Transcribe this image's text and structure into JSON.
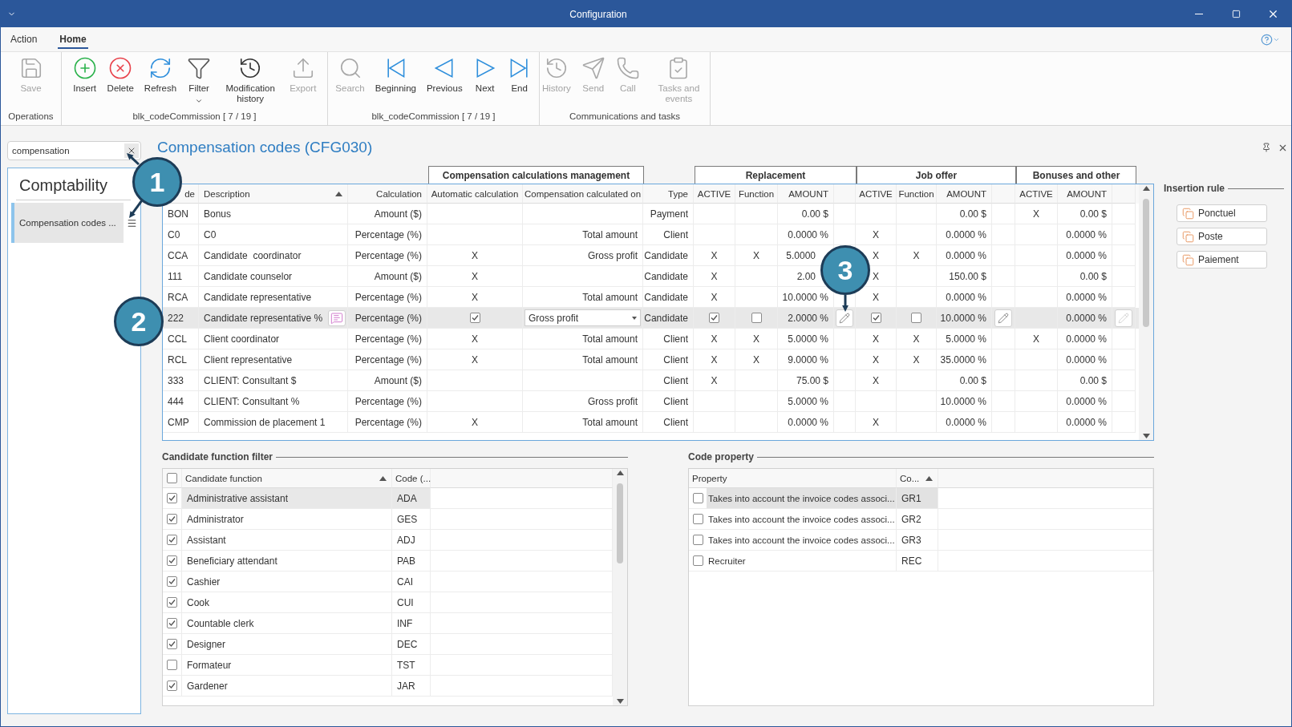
{
  "window": {
    "title": "Configuration"
  },
  "menu_tabs": [
    {
      "label": "Action",
      "selected": false
    },
    {
      "label": "Home",
      "selected": true
    }
  ],
  "ribbon": {
    "groups": [
      {
        "label": "Operations",
        "buttons": [
          {
            "label": "Save",
            "disabled": true
          }
        ]
      },
      {
        "label": "blk_codeCommission [ 7 / 19 ]",
        "buttons": [
          {
            "label": "Insert",
            "disabled": false
          },
          {
            "label": "Delete",
            "disabled": false
          },
          {
            "label": "Refresh",
            "disabled": false
          },
          {
            "label": "Filter",
            "disabled": false,
            "dropdown": true
          },
          {
            "label": "Modification history",
            "disabled": false
          },
          {
            "label": "Export",
            "disabled": true
          }
        ]
      },
      {
        "label": "blk_codeCommission [ 7 / 19 ]",
        "buttons": [
          {
            "label": "Search",
            "disabled": true
          },
          {
            "label": "Beginning",
            "disabled": false
          },
          {
            "label": "Previous",
            "disabled": false
          },
          {
            "label": "Next",
            "disabled": false
          },
          {
            "label": "End",
            "disabled": false
          }
        ]
      },
      {
        "label": "Communications and tasks",
        "buttons": [
          {
            "label": "History",
            "disabled": true
          },
          {
            "label": "Send",
            "disabled": true
          },
          {
            "label": "Call",
            "disabled": true
          },
          {
            "label": "Tasks and events",
            "disabled": true
          }
        ]
      }
    ]
  },
  "navigator": {
    "search": {
      "value": "compensation"
    },
    "title": "Comptability",
    "items": [
      {
        "label": "Compensation codes ...",
        "selected": true
      }
    ]
  },
  "page": {
    "title": "Compensation codes (CFG030)"
  },
  "table": {
    "groups": [
      "Compensation calculations management",
      "Replacement",
      "Job offer",
      "Bonuses and other"
    ],
    "columns": [
      {
        "label": "de"
      },
      {
        "label": "Description",
        "sorted": true
      },
      {
        "label": "Calculation"
      },
      {
        "label": "Automatic calculation"
      },
      {
        "label": "Compensation calculated on"
      },
      {
        "label": "Type"
      },
      {
        "label": "ACTIVE"
      },
      {
        "label": "Function"
      },
      {
        "label": "AMOUNT"
      },
      {
        "label": "ACTIVE"
      },
      {
        "label": "Function"
      },
      {
        "label": "AMOUNT"
      },
      {
        "label": "ACTIVE"
      },
      {
        "label": "AMOUNT"
      }
    ],
    "rows": [
      {
        "kind": "view",
        "selected": false,
        "code": "BON",
        "description": "Bonus",
        "calculation": "Amount ($)",
        "type": "Payment",
        "replacement_amount": "0.00 $",
        "job_offer_amount": "0.00 $",
        "bonuses_active": "X",
        "bonuses_amount": "0.00 $"
      },
      {
        "kind": "view",
        "selected": false,
        "code": "C0",
        "description": "C0",
        "calculation": "Percentage (%)",
        "calculated_on": "Total amount",
        "type": "Client",
        "replacement_amount": "0.0000 %",
        "job_offer_active": "X",
        "job_offer_amount": "0.0000 %",
        "bonuses_amount": "0.0000 %"
      },
      {
        "kind": "view",
        "selected": false,
        "code": "CCA",
        "description": "Candidate  coordinator",
        "calculation": "Percentage (%)",
        "automatic_calculation": "X",
        "calculated_on": "Gross profit",
        "type": "Candidate",
        "replacement_active": "X",
        "replacement_function": "X",
        "replacement_amount": "5.0000",
        "job_offer_active": "X",
        "job_offer_function": "X",
        "job_offer_amount": "0.0000 %",
        "bonuses_amount": "0.0000 %"
      },
      {
        "kind": "view",
        "selected": false,
        "code": "111",
        "description": "Candidate counselor",
        "calculation": "Amount ($)",
        "automatic_calculation": "X",
        "type": "Candidate",
        "replacement_active": "X",
        "replacement_amount": "2.00",
        "job_offer_active": "X",
        "job_offer_amount": "150.00 $",
        "bonuses_amount": "0.00 $"
      },
      {
        "kind": "view",
        "selected": false,
        "code": "RCA",
        "description": "Candidate representative",
        "calculation": "Percentage (%)",
        "automatic_calculation": "X",
        "calculated_on": "Total amount",
        "type": "Candidate",
        "replacement_active": "X",
        "replacement_amount": "10.0000 %",
        "job_offer_active": "X",
        "job_offer_amount": "0.0000 %",
        "bonuses_amount": "0.0000 %"
      },
      {
        "kind": "editing",
        "selected": true,
        "code": "222",
        "description": "Candidate representative %",
        "calculation": "Percentage (%)",
        "automatic_calculation": true,
        "calculated_on": "Gross profit",
        "type": "Candidate",
        "replacement_active": true,
        "replacement_function": false,
        "replacement_amount": "2.0000 %",
        "job_offer_active": true,
        "job_offer_function": false,
        "job_offer_amount": "10.0000 %",
        "bonuses_amount": "0.0000 %",
        "edit_buttons": [
          {
            "disabled": false
          },
          {
            "disabled": false
          },
          {
            "disabled": true
          }
        ]
      },
      {
        "kind": "view",
        "selected": false,
        "code": "CCL",
        "description": "Client coordinator",
        "calculation": "Percentage (%)",
        "automatic_calculation": "X",
        "calculated_on": "Total amount",
        "type": "Client",
        "replacement_active": "X",
        "replacement_function": "X",
        "replacement_amount": "5.0000 %",
        "job_offer_active": "X",
        "job_offer_function": "X",
        "job_offer_amount": "5.0000 %",
        "bonuses_active": "X",
        "bonuses_amount": "0.0000 %"
      },
      {
        "kind": "view",
        "selected": false,
        "code": "RCL",
        "description": "Client representative",
        "calculation": "Percentage (%)",
        "automatic_calculation": "X",
        "calculated_on": "Total amount",
        "type": "Client",
        "replacement_active": "X",
        "replacement_function": "X",
        "replacement_amount": "9.0000 %",
        "job_offer_active": "X",
        "job_offer_function": "X",
        "job_offer_amount": "35.0000 %",
        "bonuses_amount": "0.0000 %"
      },
      {
        "kind": "view",
        "selected": false,
        "code": "333",
        "description": "CLIENT: Consultant $",
        "calculation": "Amount ($)",
        "type": "Client",
        "replacement_active": "X",
        "replacement_amount": "75.00 $",
        "job_offer_active": "X",
        "job_offer_amount": "0.00 $",
        "bonuses_amount": "0.00 $"
      },
      {
        "kind": "view",
        "selected": false,
        "code": "444",
        "description": "CLIENT: Consultant %",
        "calculation": "Percentage (%)",
        "calculated_on": "Gross profit",
        "type": "Client",
        "replacement_amount": "5.0000 %",
        "job_offer_amount": "10.0000 %",
        "bonuses_amount": "0.0000 %"
      },
      {
        "kind": "view",
        "selected": false,
        "code": "CMP",
        "description": "Commission de placement 1",
        "calculation": "Percentage (%)",
        "automatic_calculation": "X",
        "calculated_on": "Total amount",
        "type": "Client",
        "replacement_amount": "0.0000 %",
        "job_offer_active": "X",
        "job_offer_amount": "0.0000 %",
        "bonuses_amount": "0.0000 %"
      }
    ]
  },
  "insertion_rule": {
    "title": "Insertion rule",
    "buttons": [
      "Ponctuel",
      "Poste",
      "Paiement"
    ]
  },
  "candidate_function_filter": {
    "title": "Candidate function filter",
    "all_checked": false,
    "columns": [
      {
        "label": "Candidate function",
        "sorted": true
      },
      {
        "label": "Code (..."
      }
    ],
    "rows": [
      {
        "checked": true,
        "selected": true,
        "function": "Administrative assistant",
        "code": "ADA"
      },
      {
        "checked": true,
        "selected": false,
        "function": "Administrator",
        "code": "GES"
      },
      {
        "checked": true,
        "selected": false,
        "function": "Assistant",
        "code": "ADJ"
      },
      {
        "checked": true,
        "selected": false,
        "function": "Beneficiary attendant",
        "code": "PAB"
      },
      {
        "checked": true,
        "selected": false,
        "function": "Cashier",
        "code": "CAI"
      },
      {
        "checked": true,
        "selected": false,
        "function": "Cook",
        "code": "CUI"
      },
      {
        "checked": true,
        "selected": false,
        "function": "Countable clerk",
        "code": "INF"
      },
      {
        "checked": true,
        "selected": false,
        "function": "Designer",
        "code": "DEC"
      },
      {
        "checked": false,
        "selected": false,
        "function": "Formateur",
        "code": "TST"
      },
      {
        "checked": true,
        "selected": false,
        "function": "Gardener",
        "code": "JAR"
      }
    ]
  },
  "code_property": {
    "title": "Code property",
    "columns": [
      {
        "label": "Property"
      },
      {
        "label": "Co...",
        "sorted": true
      }
    ],
    "rows": [
      {
        "checked": false,
        "selected": true,
        "property": "Takes into account the invoice codes associ...",
        "code": "GR1"
      },
      {
        "checked": false,
        "selected": false,
        "property": "Takes into account the invoice codes associ...",
        "code": "GR2"
      },
      {
        "checked": false,
        "selected": false,
        "property": "Takes into account the invoice codes associ...",
        "code": "GR3"
      },
      {
        "checked": false,
        "selected": false,
        "property": "Recruiter",
        "code": "REC"
      }
    ]
  },
  "callouts": [
    "1",
    "2",
    "3"
  ]
}
